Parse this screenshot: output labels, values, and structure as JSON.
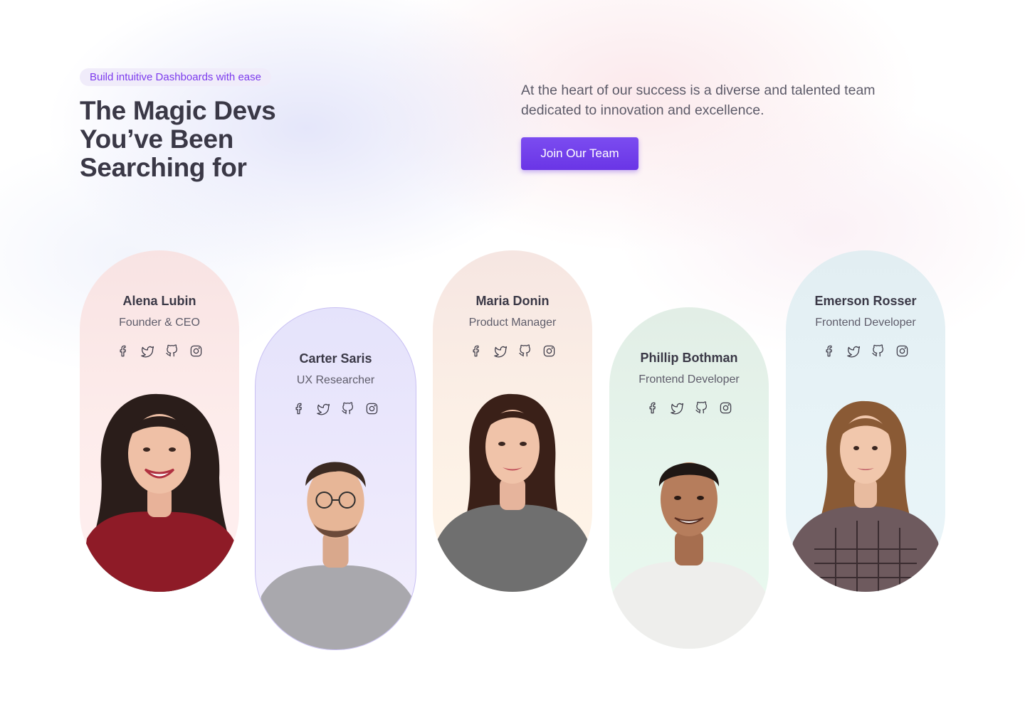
{
  "hero": {
    "badge": "Build intuitive Dashboards with ease",
    "title_lines": [
      "The Magic Devs",
      "You’ve Been",
      "Searching for"
    ],
    "intro": "At the heart of our success is a diverse and talented team dedicated to innovation and excellence.",
    "cta": "Join Our Team"
  },
  "team": [
    {
      "name": "Alena Lubin",
      "role": "Founder & CEO",
      "socials": [
        "facebook-icon",
        "twitter-icon",
        "github-icon",
        "instagram-icon"
      ]
    },
    {
      "name": "Carter Saris",
      "role": "UX Researcher",
      "socials": [
        "facebook-icon",
        "twitter-icon",
        "github-icon",
        "instagram-icon"
      ]
    },
    {
      "name": "Maria Donin",
      "role": "Product Manager",
      "socials": [
        "facebook-icon",
        "twitter-icon",
        "github-icon",
        "instagram-icon"
      ]
    },
    {
      "name": "Phillip Bothman",
      "role": "Frontend Developer",
      "socials": [
        "facebook-icon",
        "twitter-icon",
        "github-icon",
        "instagram-icon"
      ]
    },
    {
      "name": "Emerson Rosser",
      "role": "Frontend Developer",
      "socials": [
        "facebook-icon",
        "twitter-icon",
        "github-icon",
        "instagram-icon"
      ]
    }
  ],
  "colors": {
    "accent": "#6a35e6",
    "badge_bg": "#f0ecfa",
    "badge_text": "#7c3aed",
    "heading": "#3a3846"
  }
}
